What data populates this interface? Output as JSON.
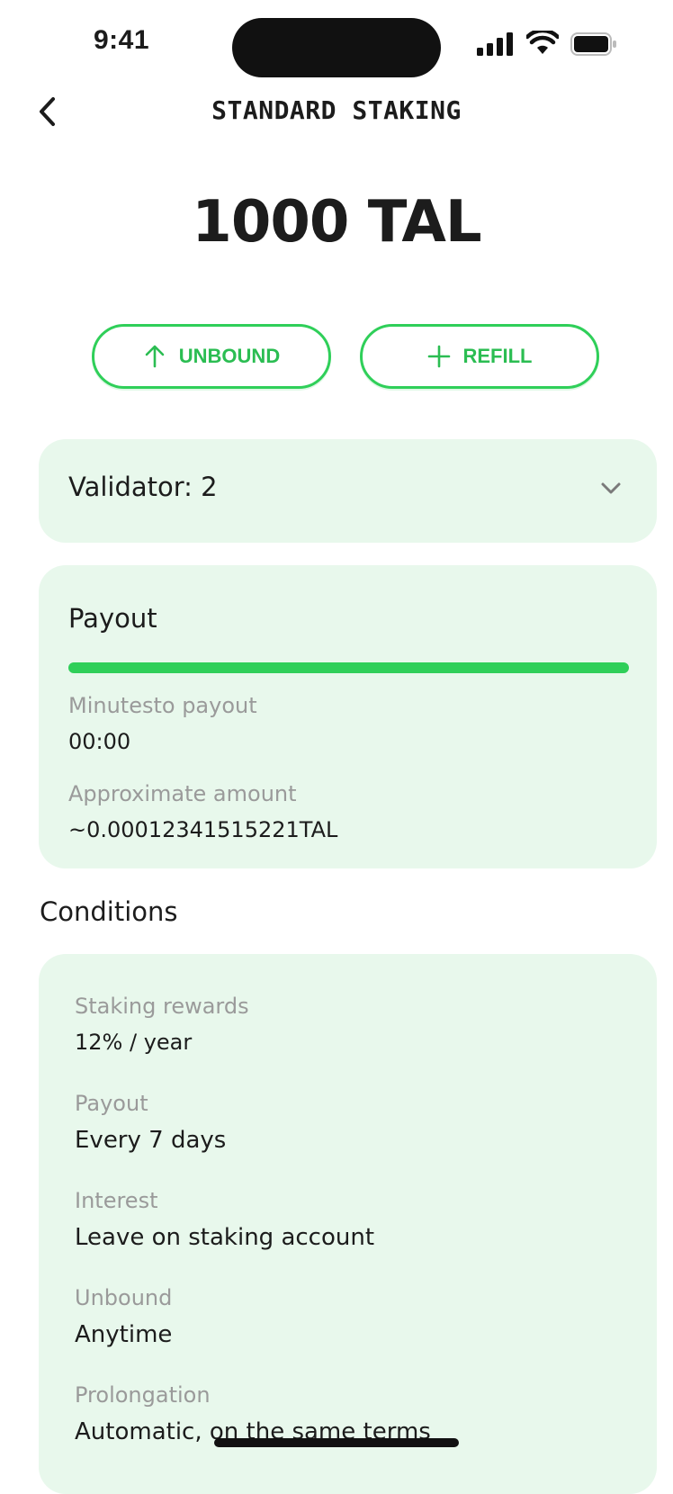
{
  "status_bar": {
    "time": "9:41"
  },
  "header": {
    "title": "STANDARD STAKING"
  },
  "balance": {
    "amount": "1000 TAL"
  },
  "actions": {
    "unbound_label": "UNBOUND",
    "refill_label": "REFILL"
  },
  "validator": {
    "label": "Validator: 2"
  },
  "payout": {
    "title": "Payout",
    "progress": 1.0,
    "minutes_label": "Minutesto payout",
    "minutes_value": "00:00",
    "amount_label": "Approximate amount",
    "amount_value": "~0.00012341515221TAL"
  },
  "conditions": {
    "title": "Conditions",
    "items": [
      {
        "label": "Staking rewards",
        "value": "12% / year"
      },
      {
        "label": "Payout",
        "value": "Every 7 days"
      },
      {
        "label": "Interest",
        "value": "Leave on staking account"
      },
      {
        "label": "Unbound",
        "value": "Anytime"
      },
      {
        "label": "Prolongation",
        "value": "Automatic, on the same terms"
      }
    ]
  },
  "colors": {
    "accent": "#2fcf59",
    "card_bg": "#e8f8ec",
    "muted_text": "#9a9a9a"
  },
  "icons": {
    "back": "chevron-left-icon",
    "unbound": "arrow-up-icon",
    "refill": "plus-icon",
    "dropdown": "chevron-down-icon"
  }
}
